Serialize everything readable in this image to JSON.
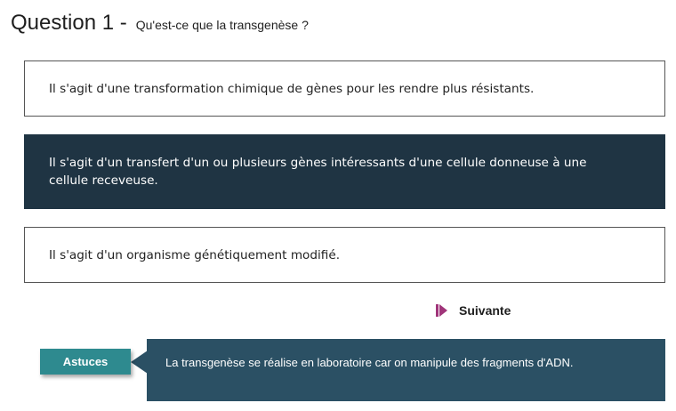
{
  "question": {
    "number_label": "Question 1 -",
    "text": "Qu'est-ce que la transgenèse ?"
  },
  "answers": [
    {
      "text": "Il s'agit d'une transformation chimique de gènes pour les rendre plus résistants.",
      "selected": false
    },
    {
      "text": "Il s'agit d'un transfert d'un ou plusieurs gènes intéressants d'une cellule donneuse à une cellule receveuse.",
      "selected": true
    },
    {
      "text": "Il s'agit d'un organisme génétiquement modifié.",
      "selected": false
    }
  ],
  "next_button": {
    "label": "Suivante",
    "icon": "skip-forward-icon",
    "icon_color": "#a0357a"
  },
  "hint": {
    "tab_label": "Astuces",
    "text": "La transgenèse se réalise en laboratoire car on manipule des fragments d'ADN."
  },
  "colors": {
    "selected_answer_bg": "#1f3443",
    "hint_panel_bg": "#2b5064",
    "hint_tab_bg": "#2e8a8f"
  }
}
